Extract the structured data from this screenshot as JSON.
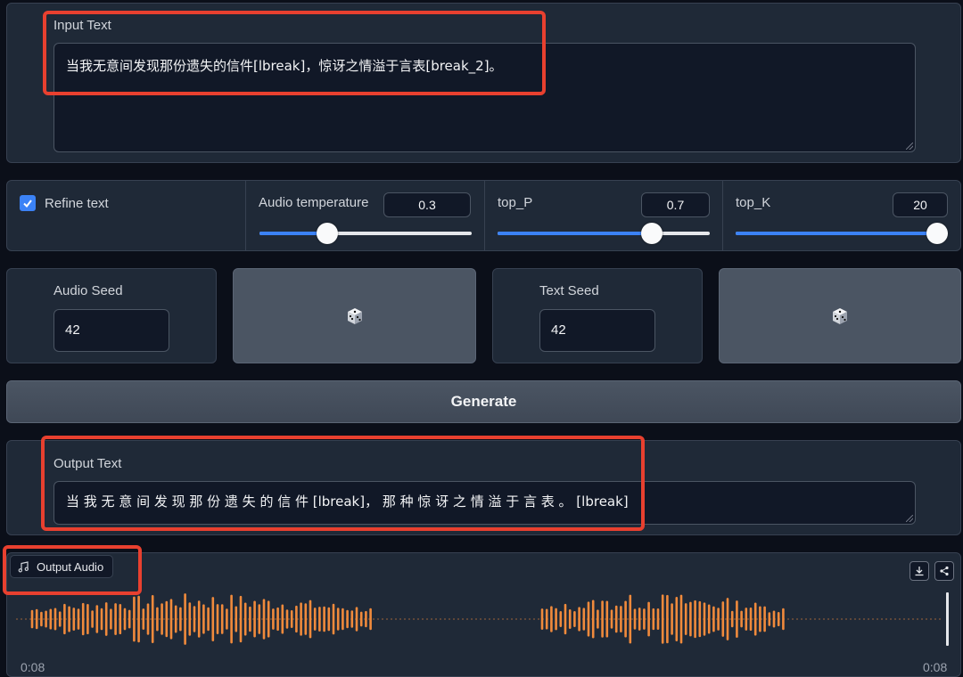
{
  "input": {
    "label": "Input Text",
    "value": "当我无意间发现那份遗失的信件[lbreak]，惊讶之情溢于言表[break_2]。"
  },
  "controls": {
    "refine_label": "Refine text",
    "refine_checked": true,
    "sliders": [
      {
        "label": "Audio temperature",
        "value": "0.3",
        "fraction": 0.32
      },
      {
        "label": "top_P",
        "value": "0.7",
        "fraction": 0.725
      },
      {
        "label": "top_K",
        "value": "20",
        "fraction": 0.95
      }
    ]
  },
  "seeds": {
    "audio_label": "Audio Seed",
    "audio_value": "42",
    "text_label": "Text Seed",
    "text_value": "42",
    "dice_icon": "dice-icon"
  },
  "generate_label": "Generate",
  "output": {
    "label": "Output Text",
    "value": "当 我 无 意 间 发 现 那 份 遗 失 的 信 件 [lbreak]， 那 种 惊 讶 之 情 溢 于 言 表 。 [lbreak]"
  },
  "audio": {
    "label": "Output Audio",
    "time_start": "0:08",
    "time_end": "0:08",
    "wave_color": "#f08a3c"
  },
  "colors": {
    "highlight": "#e8402f",
    "accent": "#3b82f6"
  }
}
